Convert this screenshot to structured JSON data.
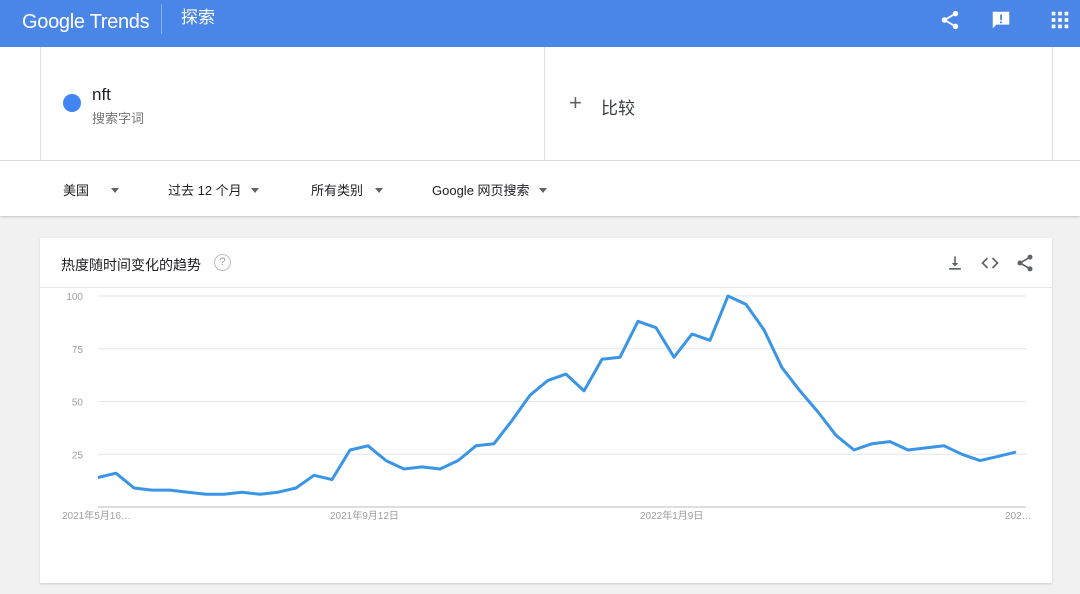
{
  "header": {
    "logo": "Google Trends",
    "page_title": "探索",
    "icons": [
      "share-icon",
      "feedback-icon",
      "apps-grid-icon"
    ]
  },
  "terms": {
    "primary": {
      "name": "nft",
      "subtitle": "搜索字词",
      "color": "#4285f4"
    },
    "compare_label": "比较",
    "compare_icon": "plus-icon"
  },
  "filters": {
    "region": "美国",
    "time": "过去 12 个月",
    "category": "所有类别",
    "search_type": "Google 网页搜索"
  },
  "card": {
    "title": "热度随时间变化的趋势",
    "help_icon": "help-icon",
    "actions": [
      "download-icon",
      "embed-icon",
      "share-icon"
    ]
  },
  "chart_data": {
    "type": "line",
    "ylim": [
      0,
      100
    ],
    "yticks": [
      25,
      50,
      75,
      100
    ],
    "x_tick_labels": [
      "2021年5月16…",
      "2021年9月12日",
      "2022年1月9日",
      "202…"
    ],
    "grid": true,
    "series": [
      {
        "color": "#3a95e6",
        "values": [
          14,
          16,
          9,
          8,
          8,
          7,
          6,
          6,
          7,
          6,
          7,
          9,
          15,
          13,
          27,
          29,
          22,
          18,
          19,
          18,
          22,
          29,
          30,
          41,
          53,
          60,
          63,
          55,
          70,
          71,
          88,
          85,
          71,
          82,
          79,
          100,
          96,
          84,
          66,
          55,
          45,
          34,
          27,
          30,
          31,
          27,
          28,
          29,
          25,
          22,
          24,
          26
        ]
      }
    ]
  }
}
